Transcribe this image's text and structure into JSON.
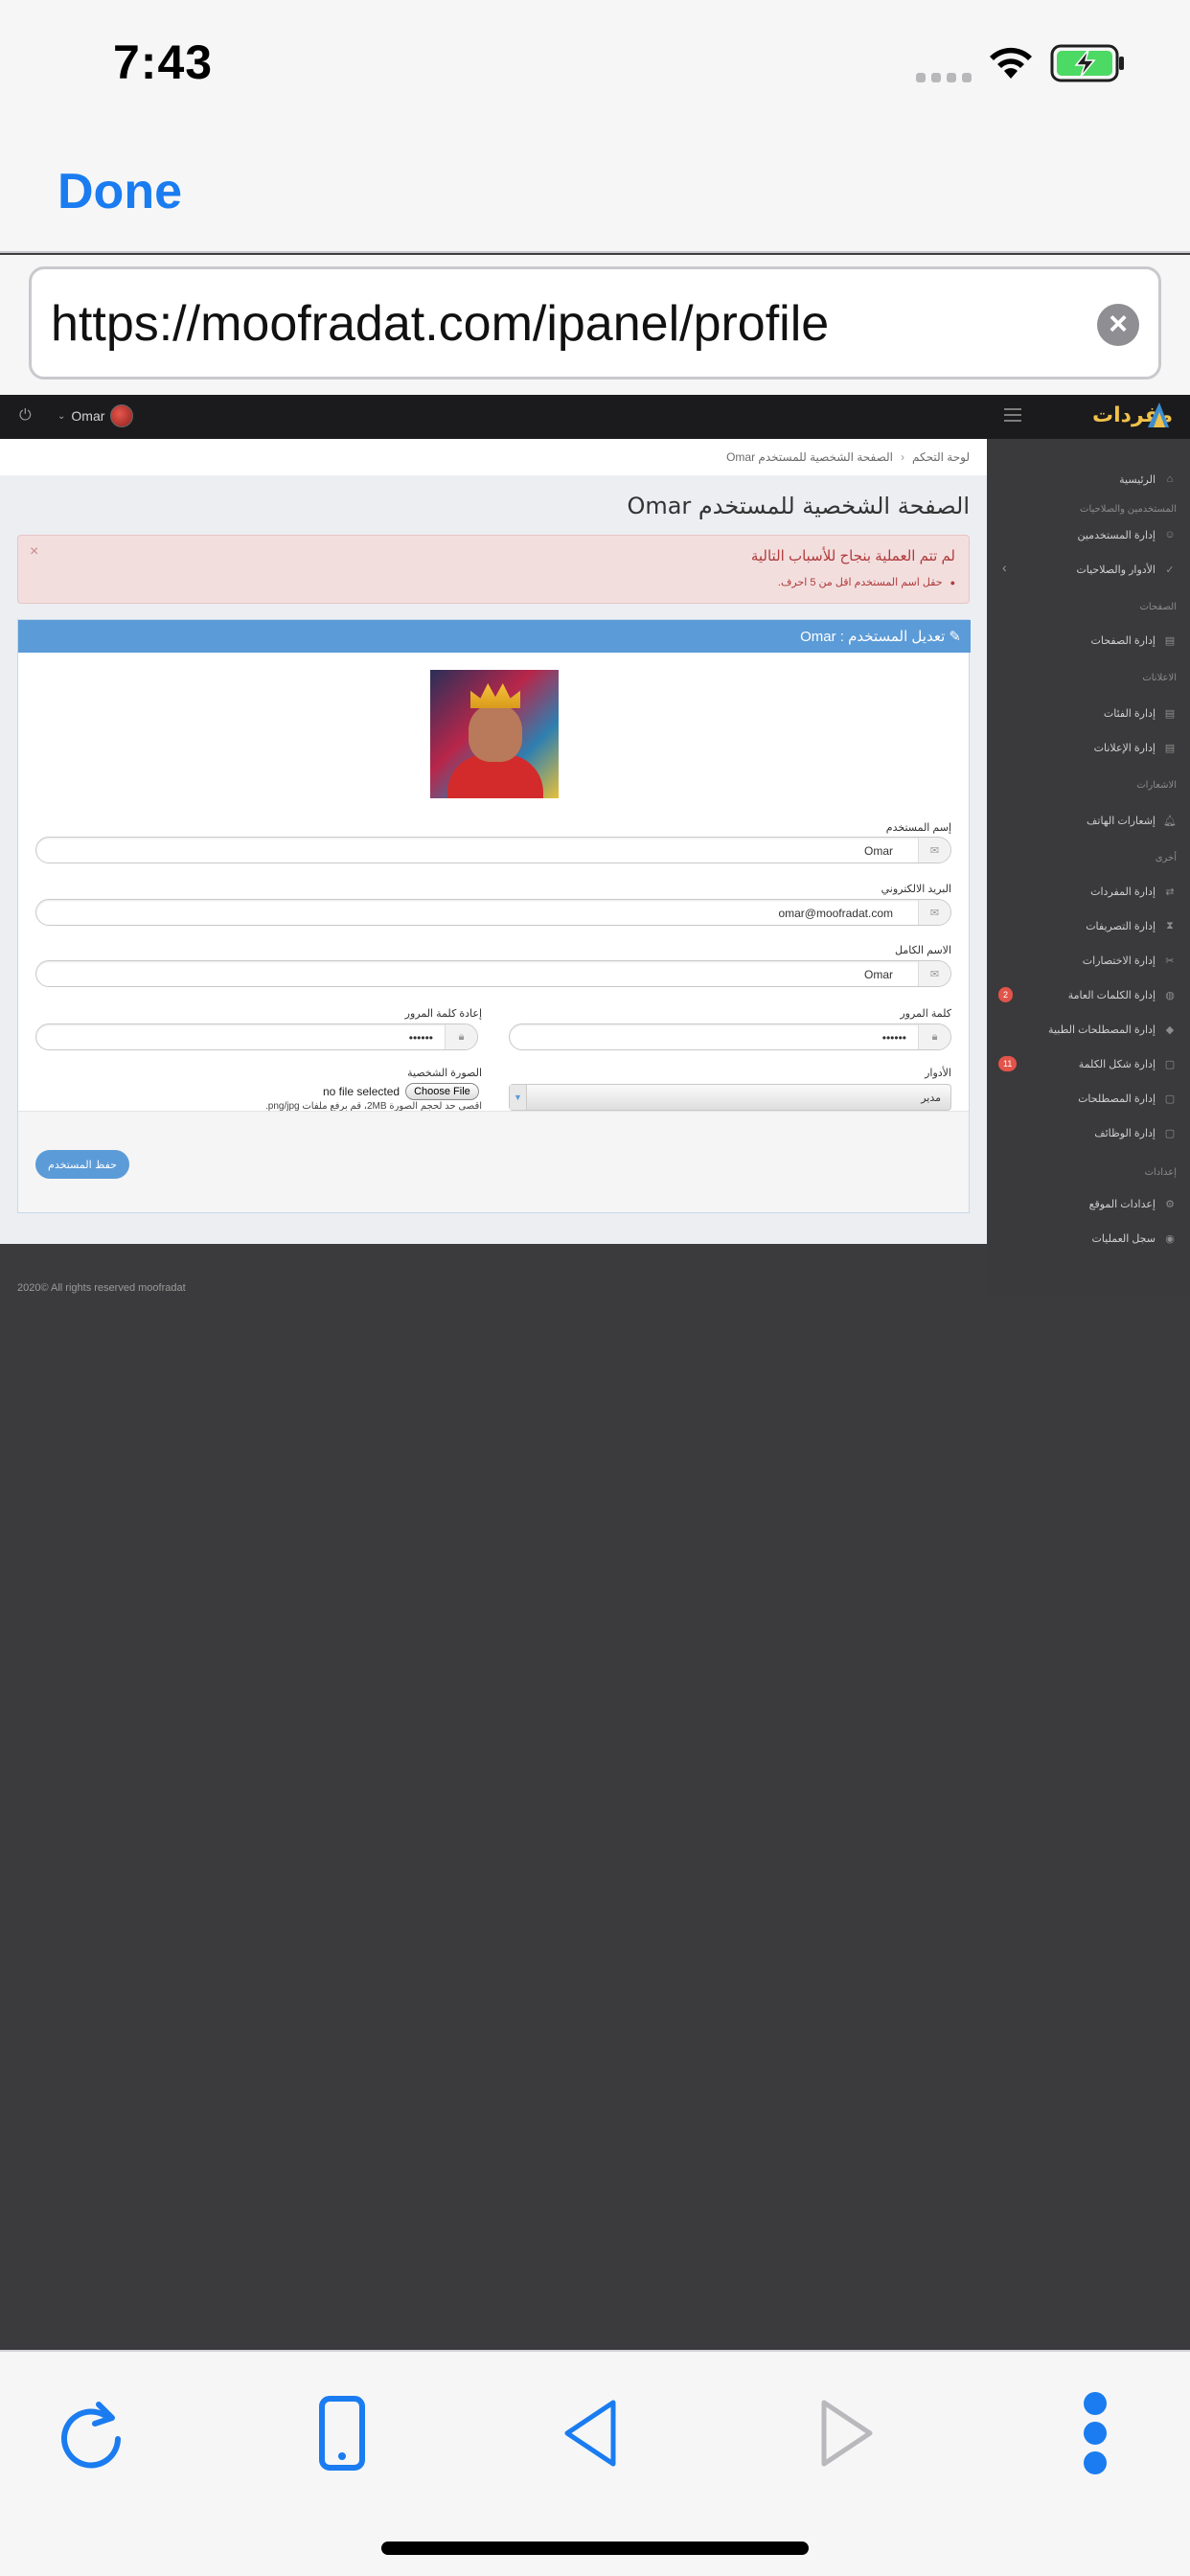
{
  "status_bar": {
    "time": "7:43"
  },
  "browser": {
    "done_label": "Done",
    "url": "https://moofradat.com/ipanel/profile"
  },
  "topbar": {
    "user_name": "Omar",
    "logo_text": "مفردات"
  },
  "breadcrumb": {
    "home": "لوحة التحكم",
    "current": "الصفحة الشخصية للمستخدم Omar"
  },
  "page_title": "الصفحة الشخصية للمستخدم Omar",
  "alert": {
    "close": "×",
    "title": "لم تتم العملية بنجاح للأسباب التالية",
    "error": "حقل اسم المستخدم اقل من 5 احرف."
  },
  "panel": {
    "title": "تعديل المستخدم : Omar"
  },
  "form": {
    "username_label": "إسم المستخدم",
    "username_value": "Omar",
    "email_label": "البريد الالكتروني",
    "email_value": "omar@moofradat.com",
    "fullname_label": "الاسم الكامل",
    "fullname_value": "Omar",
    "password_label": "كلمة المرور",
    "password_value": "••••••",
    "password_confirm_label": "إعادة كلمة المرور",
    "password_confirm_value": "••••••",
    "roles_label": "الأدوار",
    "roles_value": "مدير",
    "photo_label": "الصورة الشخصية",
    "file_status": "no file selected",
    "choose_file": "Choose File",
    "file_hint": "اقصى حد لحجم الصورة 2MB، قم برفع ملفات png/jpg.",
    "save_label": "حفظ المستخدم"
  },
  "footer": {
    "copyright": "2020© All rights reserved moofradat"
  },
  "sidebar": {
    "home": "الرئيسية",
    "section_users": "المستخدمين والصلاحيات",
    "users": "إدارة المستخدمين",
    "roles": "الأدوار والصلاحيات",
    "section_pages": "الصفحات",
    "pages": "إدارة الصفحات",
    "section_ads": "الاعلانات",
    "categories": "إدارة الفئات",
    "ads": "إدارة الإعلانات",
    "section_notifications": "الاشعارات",
    "phone_notifications": "إشعارات الهاتف",
    "section_other": "أخرى",
    "vocab": "إدارة المفردات",
    "conjugations": "إدارة التصريفات",
    "abbreviations": "إدارة الاختصارات",
    "common_words": "إدارة الكلمات العامة",
    "common_words_badge": "2",
    "medical_terms": "إدارة المصطلحات الطبية",
    "word_forms": "إدارة شكل الكلمة",
    "word_forms_badge": "11",
    "terms": "إدارة المصطلحات",
    "jobs": "إدارة الوظائف",
    "section_settings": "إعدادات",
    "site_settings": "إعدادات الموقع",
    "activity_log": "سجل العمليات"
  },
  "colors": {
    "ios_blue": "#1a7cf0",
    "panel_header": "#5b9bd7",
    "alert_text": "#b03b3b",
    "badge": "#e2544a"
  }
}
